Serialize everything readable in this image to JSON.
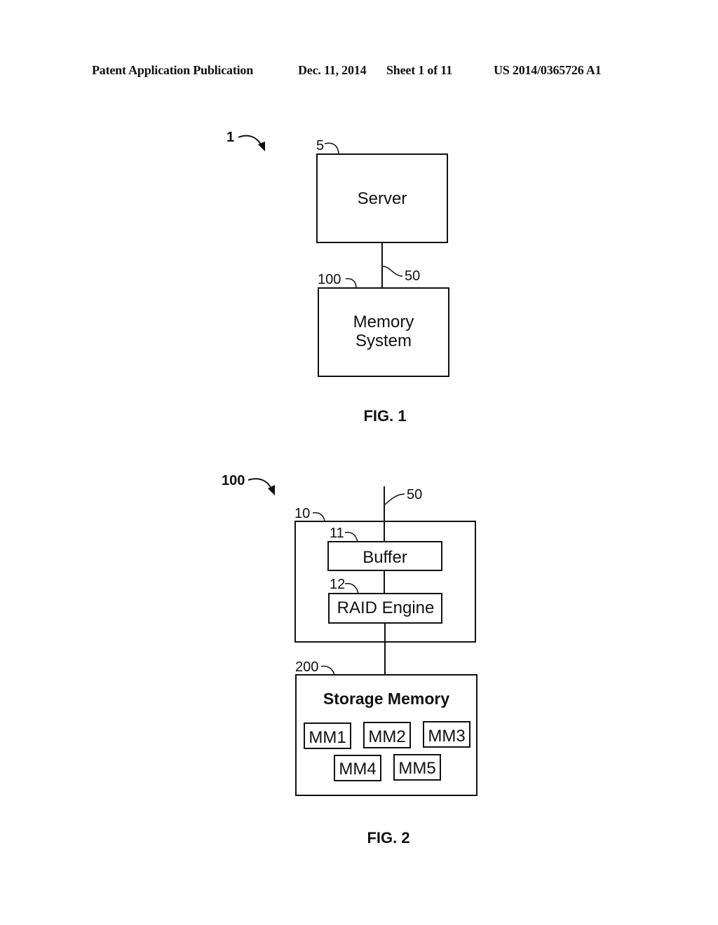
{
  "header": {
    "publication": "Patent Application Publication",
    "date": "Dec. 11, 2014",
    "sheet": "Sheet 1 of 11",
    "number": "US 2014/0365726 A1"
  },
  "fig1": {
    "caption": "FIG. 1",
    "ref_system": "1",
    "server": {
      "ref": "5",
      "label": "Server"
    },
    "link": {
      "ref": "50"
    },
    "memory_system": {
      "ref": "100",
      "label_line1": "Memory",
      "label_line2": "System"
    }
  },
  "fig2": {
    "caption": "FIG. 2",
    "ref_system": "100",
    "link": {
      "ref": "50"
    },
    "controller": {
      "ref": "10"
    },
    "buffer": {
      "ref": "11",
      "label": "Buffer"
    },
    "raid_engine": {
      "ref": "12",
      "label": "RAID Engine"
    },
    "storage_memory": {
      "ref": "200",
      "label": "Storage Memory",
      "modules": [
        "MM1",
        "MM2",
        "MM3",
        "MM4",
        "MM5"
      ]
    }
  }
}
